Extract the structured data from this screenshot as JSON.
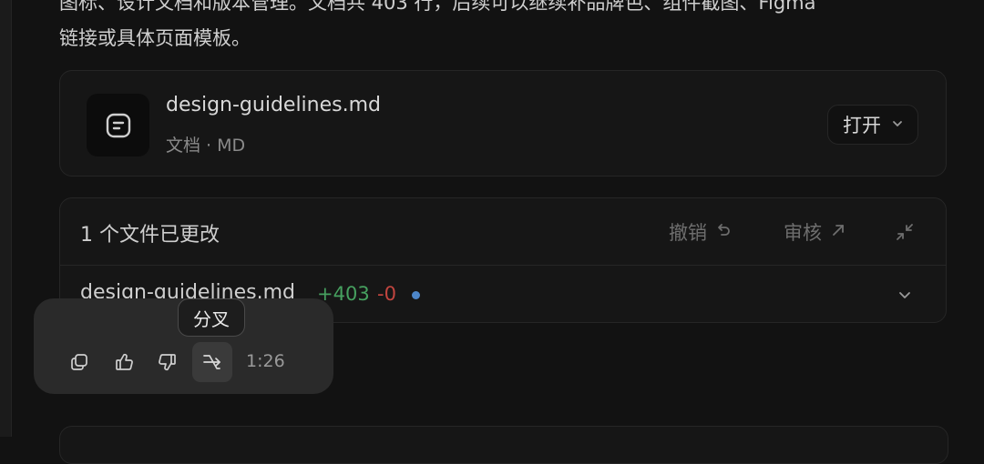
{
  "message": {
    "paragraph": "图标、设计文档和版本管理。文档共 403 行，后续可以继续补品牌色、组件截图、Figma\n链接或具体页面模板。"
  },
  "file_card": {
    "name": "design-guidelines.md",
    "meta": "文档 · MD",
    "open_label": "打开",
    "icon": "document-icon"
  },
  "changes": {
    "title": "1 个文件已更改",
    "undo_label": "撤销",
    "review_label": "审核",
    "files": [
      {
        "name": "design-guidelines.md",
        "additions": "+403",
        "deletions": "-0"
      }
    ]
  },
  "actions": {
    "tooltip": "分叉",
    "duration": "1:26",
    "icons": [
      "copy-icon",
      "thumbs-up-icon",
      "thumbs-down-icon",
      "fork-icon"
    ]
  },
  "colors": {
    "background": "#121212",
    "card": "#161616",
    "additions": "#46a05f",
    "deletions": "#c2453f",
    "status_dot": "#4d86c8"
  }
}
